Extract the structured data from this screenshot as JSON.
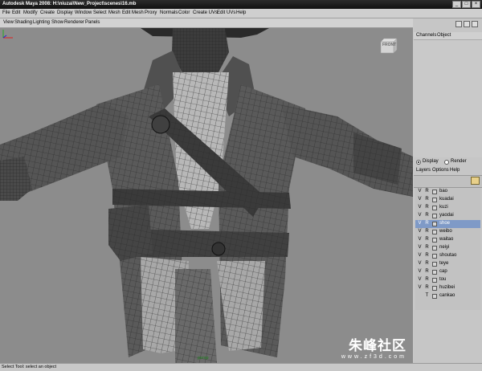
{
  "window": {
    "title": "Autodesk Maya 2008: H:\\niuzai\\New_Project\\scenes\\16.mb",
    "controls": [
      "_",
      "□",
      "×"
    ]
  },
  "menubar": [
    "File",
    "Edit",
    "Modify",
    "Create",
    "Display",
    "Window",
    "Select",
    "Mesh",
    "Edit Mesh",
    "Proxy",
    "Normals",
    "Color",
    "Create UVs",
    "Edit UVs",
    "Help"
  ],
  "panel_menu": [
    "View",
    "Shading",
    "Lighting",
    "Show",
    "Renderer",
    "Panels"
  ],
  "viewport": {
    "view_cube": "FRONT",
    "camera_label": "persp"
  },
  "channel_box": {
    "tabs": [
      "Channels",
      "Object"
    ]
  },
  "layer_editor": {
    "modes": [
      "Display",
      "Render"
    ],
    "selected_mode": "Display",
    "menu": [
      "Layers",
      "Options",
      "Help"
    ],
    "layers": [
      {
        "v": "V",
        "r": "R",
        "name": "bao",
        "selected": false
      },
      {
        "v": "V",
        "r": "R",
        "name": "kuadai",
        "selected": false
      },
      {
        "v": "V",
        "r": "R",
        "name": "kuzi",
        "selected": false
      },
      {
        "v": "V",
        "r": "R",
        "name": "yaodai",
        "selected": false
      },
      {
        "v": "V",
        "r": "R",
        "name": "shoe",
        "selected": true
      },
      {
        "v": "V",
        "r": "R",
        "name": "weibo",
        "selected": false
      },
      {
        "v": "V",
        "r": "R",
        "name": "waitao",
        "selected": false
      },
      {
        "v": "V",
        "r": "R",
        "name": "neiyi",
        "selected": false
      },
      {
        "v": "V",
        "r": "R",
        "name": "shoutao",
        "selected": false
      },
      {
        "v": "V",
        "r": "R",
        "name": "teye",
        "selected": false
      },
      {
        "v": "V",
        "r": "R",
        "name": "cap",
        "selected": false
      },
      {
        "v": "V",
        "r": "R",
        "name": "tou",
        "selected": false
      },
      {
        "v": "V",
        "r": "R",
        "name": "huzibei",
        "selected": false
      },
      {
        "v": "",
        "r": "T",
        "name": "cankao",
        "selected": false
      }
    ]
  },
  "watermark": {
    "text": "朱峰社区",
    "url": "www.zf3d.com"
  },
  "help_line": "Select Tool: select an object",
  "colors": {
    "viewport_bg": "#8c8c8c",
    "selection": "#7f9ac7",
    "titlebar": "#1c1c1c"
  }
}
